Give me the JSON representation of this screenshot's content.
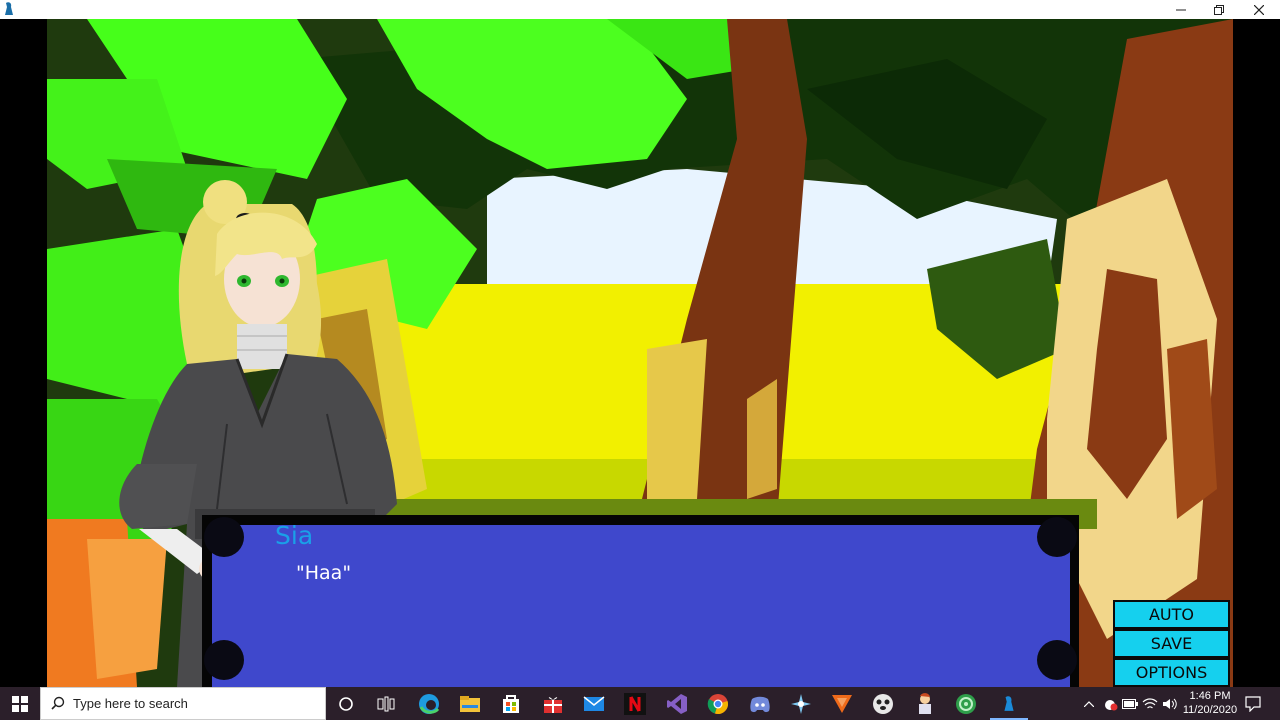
{
  "window": {
    "controls": {
      "minimize_icon": "minimize-icon",
      "maximize_icon": "maximize-icon",
      "close_icon": "close-icon"
    }
  },
  "dialog": {
    "speaker": "Sia",
    "text": "\"Haa\""
  },
  "menu": {
    "auto_label": "AUTO",
    "save_label": "SAVE",
    "options_label": "OPTIONS"
  },
  "taskbar": {
    "search_placeholder": "Type here to search",
    "pinned_icons": [
      "cortana-icon",
      "task-view-icon",
      "edge-icon",
      "file-explorer-icon",
      "store-icon",
      "gift-app-icon",
      "mail-icon",
      "netflix-icon",
      "visual-studio-icon",
      "chrome-icon",
      "discord-icon",
      "game-app-icon",
      "vivaldi-icon",
      "panda-app-icon",
      "character-app-icon",
      "green-app-icon",
      "game-window-icon"
    ],
    "time": "1:46 PM",
    "date": "11/20/2020"
  },
  "colors": {
    "dialog_bg": "#3f48cc",
    "speaker_name": "#1aa0e8",
    "menu_button": "#15d0ee",
    "taskbar": "#2b1f2a"
  }
}
